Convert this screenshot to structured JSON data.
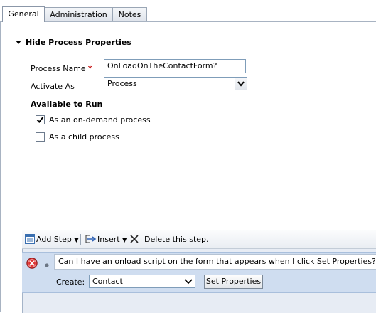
{
  "tabs": [
    {
      "label": "General"
    },
    {
      "label": "Administration"
    },
    {
      "label": "Notes"
    }
  ],
  "section": {
    "title": "Hide Process Properties"
  },
  "form": {
    "process_name_label": "Process Name",
    "required_mark": "*",
    "process_name_value": "OnLoadOnTheContactForm?",
    "activate_as_label": "Activate As",
    "activate_as_value": "Process",
    "available_to_run_label": "Available to Run",
    "on_demand_label": "As an on-demand process",
    "on_demand_checked": true,
    "child_process_label": "As a child process",
    "child_process_checked": false
  },
  "toolbar": {
    "add_step": "Add Step",
    "insert": "Insert",
    "delete": "Delete this step."
  },
  "step": {
    "description": "Can I have an onload script on the form that appears when I click Set Properties?",
    "create_label": "Create:",
    "create_value": "Contact",
    "set_properties": "Set Properties"
  }
}
